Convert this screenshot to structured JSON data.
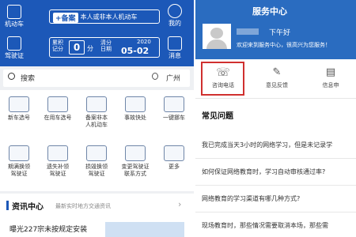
{
  "left_app": {
    "header": {
      "vehicle_label": "机动车",
      "add_button_plus": "+备案",
      "add_button_text": "本人或非本人机动车",
      "license_label": "驾驶证",
      "points_label": "累积\n记分",
      "points_value": "0",
      "points_unit": "分",
      "clear_label": "清分\n日期",
      "clear_year": "2020",
      "clear_date": "05-02",
      "mine_label": "我的",
      "messages_label": "消息"
    },
    "search": {
      "placeholder": "搜索",
      "city": "广州"
    },
    "services": [
      {
        "label": "新车选号"
      },
      {
        "label": "在用车选号"
      },
      {
        "label": "备案非本\n人机动车"
      },
      {
        "label": "事故快处"
      },
      {
        "label": "一键挪车"
      },
      {
        "label": "期满换领\n驾驶证"
      },
      {
        "label": "遗失补领\n驾驶证"
      },
      {
        "label": "损毁换领\n驾驶证"
      },
      {
        "label": "变更驾驶证\n联系方式"
      },
      {
        "label": "更多"
      }
    ],
    "news": {
      "title": "资讯中心",
      "subtitle": "最新实时地方交通资讯",
      "headline": "曝光227宗未按规定安装"
    }
  },
  "right_app": {
    "title": "服务中心",
    "greeting": "下午好",
    "welcome": "欢迎来到服务中心，很高兴为您服务！",
    "actions": [
      {
        "label": "咨询电话"
      },
      {
        "label": "意见反馈"
      },
      {
        "label": "信息申"
      }
    ],
    "faq_title": "常见问题",
    "faqs": [
      "我已完成当天3小时的网络学习，但是未记录学",
      "如何保证网络教育时，学习自动审核通过率?",
      "网络教育的学习渠道有哪几种方式?",
      "现场教育时，那些情况需要取消本场，那些需"
    ]
  },
  "colors": {
    "brand_blue": "#1c58b8",
    "highlight_red": "#d0302f",
    "news_bar": "#1c58b8"
  }
}
